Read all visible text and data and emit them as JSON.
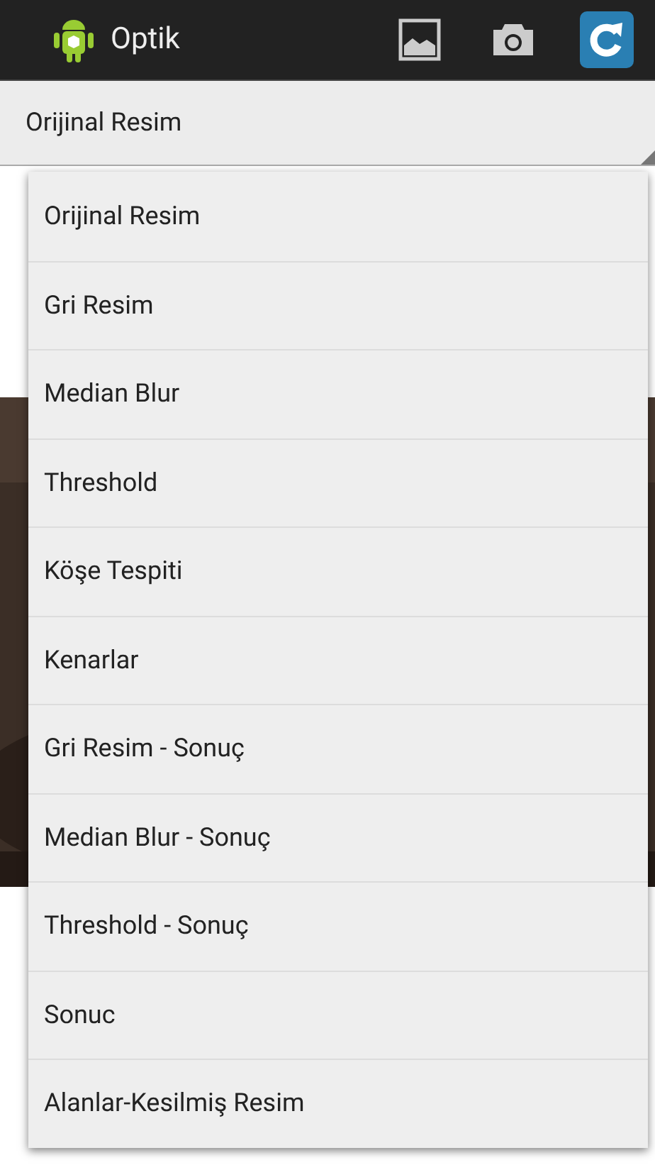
{
  "action_bar": {
    "title": "Optik"
  },
  "spinner": {
    "value": "Orijinal Resim"
  },
  "dropdown": {
    "items": [
      {
        "label": "Orijinal Resim"
      },
      {
        "label": "Gri Resim"
      },
      {
        "label": "Median Blur"
      },
      {
        "label": "Threshold"
      },
      {
        "label": "Köşe Tespiti"
      },
      {
        "label": "Kenarlar"
      },
      {
        "label": "Gri Resim - Sonuç"
      },
      {
        "label": "Median Blur - Sonuç"
      },
      {
        "label": "Threshold - Sonuç"
      },
      {
        "label": "Sonuc"
      },
      {
        "label": "Alanlar-Kesilmiş Resim"
      }
    ]
  }
}
